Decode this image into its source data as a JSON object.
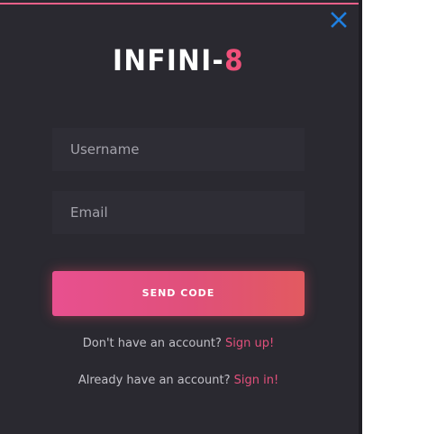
{
  "modal": {
    "logo_main": "INFINI-",
    "logo_accent": "8",
    "close_icon": "close-icon",
    "username_placeholder": "Username",
    "email_placeholder": "Email",
    "send_button_label": "SEND CODE",
    "signup_prompt": "Don't have an account?",
    "signup_link": "Sign up!",
    "signin_prompt": "Already have an account?",
    "signin_link": "Sign in!"
  },
  "colors": {
    "background": "#2a2930",
    "accent": "#f0507a",
    "close_icon": "#1f7fe0",
    "input_background": "#2e2d35"
  }
}
